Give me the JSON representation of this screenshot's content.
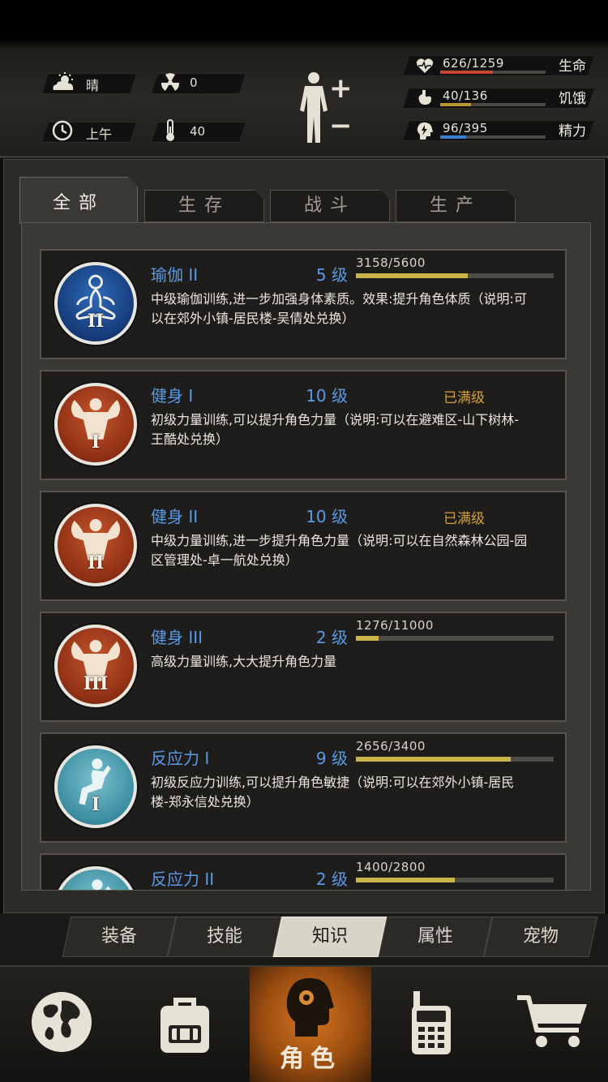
{
  "status": {
    "weather": "晴",
    "radiation": "0",
    "time_of_day": "上午",
    "temperature": "40"
  },
  "vitals": [
    {
      "key": "life",
      "value": "626/1259",
      "name": "生命",
      "fill": 0.497,
      "color": "#c8462e"
    },
    {
      "key": "hunger",
      "value": "40/136",
      "name": "饥饿",
      "fill": 0.294,
      "color": "#b9962e"
    },
    {
      "key": "energy",
      "value": "96/395",
      "name": "精力",
      "fill": 0.243,
      "color": "#3a7fd0"
    }
  ],
  "body_buttons": {
    "plus": "+",
    "minus": "−"
  },
  "category_tabs": [
    "全部",
    "生存",
    "战斗",
    "生产"
  ],
  "skills": [
    {
      "name": "瑜伽 II",
      "level": "5 级",
      "xp": "3158/5600",
      "progress": 0.564,
      "maxed": "",
      "roman": "II",
      "color": "blue",
      "icon": "yoga-icon",
      "desc": "中级瑜伽训练,进一步加强身体素质。效果:提升角色体质（说明:可以在郊外小镇-居民楼-吴倩处兑换）"
    },
    {
      "name": "健身 I",
      "level": "10 级",
      "xp": "",
      "progress": null,
      "maxed": "已满级",
      "roman": "I",
      "color": "red",
      "icon": "muscle-icon",
      "desc": "初级力量训练,可以提升角色力量（说明:可以在避难区-山下树林-王酷处兑换）"
    },
    {
      "name": "健身 II",
      "level": "10 级",
      "xp": "",
      "progress": null,
      "maxed": "已满级",
      "roman": "II",
      "color": "red",
      "icon": "muscle-icon",
      "desc": "中级力量训练,进一步提升角色力量（说明:可以在自然森林公园-园区管理处-卓一航处兑换）"
    },
    {
      "name": "健身 III",
      "level": "2 级",
      "xp": "1276/11000",
      "progress": 0.116,
      "maxed": "",
      "roman": "III",
      "color": "red",
      "icon": "muscle-icon",
      "desc": "高级力量训练,大大提升角色力量"
    },
    {
      "name": "反应力 I",
      "level": "9 级",
      "xp": "2656/3400",
      "progress": 0.781,
      "maxed": "",
      "roman": "I",
      "color": "teal",
      "icon": "kick-icon",
      "desc": "初级反应力训练,可以提升角色敏捷（说明:可以在郊外小镇-居民楼-郑永信处兑换）"
    },
    {
      "name": "反应力 II",
      "level": "2 级",
      "xp": "1400/2800",
      "progress": 0.5,
      "maxed": "",
      "roman": "II",
      "color": "teal",
      "icon": "kick-icon",
      "desc": ""
    }
  ],
  "sub_tabs": [
    "装备",
    "技能",
    "知识",
    "属性",
    "宠物"
  ],
  "sub_tab_active": 2,
  "bottom_nav": [
    {
      "icon": "globe-icon",
      "label": ""
    },
    {
      "icon": "backpack-icon",
      "label": ""
    },
    {
      "icon": "character-head-icon",
      "label": "角色"
    },
    {
      "icon": "walkie-talkie-icon",
      "label": ""
    },
    {
      "icon": "shopping-cart-icon",
      "label": ""
    }
  ]
}
